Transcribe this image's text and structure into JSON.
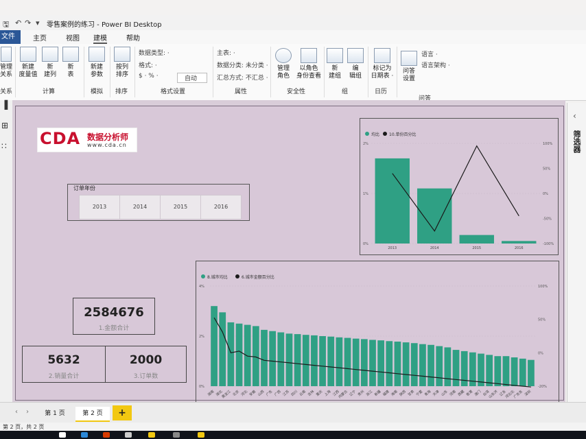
{
  "window": {
    "title": "零售案例的练习 - Power BI Desktop"
  },
  "menu": {
    "file": "文件",
    "tabs": [
      "主页",
      "视图",
      "建模",
      "帮助"
    ]
  },
  "ribbon": {
    "manage_rel": "管理\n关系",
    "new_measure": "新建\n度量值",
    "new_column": "新\n建列",
    "new_table": "新\n表",
    "new_param": "新建\n参数",
    "sort_by_col": "按列\n排序",
    "data_type": "数据类型: ·",
    "format": "格式: ·",
    "currency": "$ · % ·",
    "auto": "自动",
    "home_table": "主表: ·",
    "data_category": "数据分类: 未分类 ·",
    "summarize": "汇总方式: 不汇总 ·",
    "manage_roles": "管理\n角色",
    "view_as": "以角色\n身份查看",
    "new_group": "新\n建组",
    "edit_group": "编\n辑组",
    "mark_date": "标记为\n日期表 ·",
    "qa_setup": "问答\n设置",
    "language": "语言 ·",
    "linguistic": "语言架构 ·",
    "groups": {
      "relations": "关系",
      "calc": "计算",
      "whatif": "模拟",
      "sort": "排序",
      "formatting": "格式设置",
      "properties": "属性",
      "security": "安全性",
      "group": "组",
      "calendar": "日历",
      "qa": "问答"
    }
  },
  "right_panel": {
    "filters": "筛选器"
  },
  "slicer": {
    "title": "订单年份",
    "years": [
      "2013",
      "2014",
      "2015",
      "2016"
    ]
  },
  "cards": {
    "sales_amount": {
      "value": "2584676",
      "label": "1.金额合计"
    },
    "sales_qty": {
      "value": "5632",
      "label": "2.销量合计"
    },
    "order_count": {
      "value": "2000",
      "label": "3.订单数"
    }
  },
  "pages": {
    "page1": "第 1 页",
    "page2": "第 2 页",
    "add": "+"
  },
  "status": {
    "text": "第 2 页，共 2 页"
  },
  "chart_data": [
    {
      "type": "bar",
      "legend": [
        "均比",
        "10.单份百分比"
      ],
      "categories": [
        "2013",
        "2014",
        "2015",
        "2016"
      ],
      "series": [
        {
          "name": "均比",
          "values": [
            1.7,
            1.1,
            0.17,
            0.05
          ]
        },
        {
          "name": "10.单份百分比",
          "values": [
            40,
            -75,
            95,
            -45
          ]
        }
      ],
      "y_left_ticks": [
        "2%",
        "1%",
        "0%"
      ],
      "y_right_ticks": [
        "100%",
        "50%",
        "0%",
        "-50%",
        "-100%"
      ],
      "ylim": [
        0,
        2
      ],
      "y2lim": [
        -100,
        100
      ],
      "legend_position": "top-left",
      "colors": {
        "bar": "#2fa084",
        "line": "#1a1a1a"
      }
    },
    {
      "type": "bar",
      "legend": [
        "8.城市均比",
        "6.城市金额百分比"
      ],
      "categories": [
        "湖南",
        "湖北",
        "黑龙江",
        "北京",
        "河北",
        "安徽",
        "山西",
        "广东",
        "广西",
        "江苏",
        "四川",
        "云南",
        "吉林",
        "重庆",
        "上海",
        "江西",
        "内蒙古",
        "辽宁",
        "贵州",
        "浙江",
        "新疆",
        "福建",
        "海南",
        "陕西",
        "甘肃",
        "宁夏",
        "青海",
        "天津",
        "山东",
        "河南",
        "西藏",
        "香港",
        "澳门",
        "台湾",
        "山东济",
        "辽东",
        "河北北",
        "广东东",
        "深圳"
      ],
      "series": [
        {
          "name": "8.城市均比",
          "values": [
            3.2,
            2.95,
            2.55,
            2.5,
            2.45,
            2.4,
            2.25,
            2.2,
            2.15,
            2.1,
            2.08,
            2.05,
            2.03,
            2.0,
            1.98,
            1.95,
            1.93,
            1.9,
            1.88,
            1.85,
            1.83,
            1.8,
            1.78,
            1.75,
            1.72,
            1.68,
            1.65,
            1.6,
            1.55,
            1.45,
            1.4,
            1.35,
            1.3,
            1.25,
            1.2,
            1.2,
            1.15,
            1.1,
            1.05
          ]
        },
        {
          "name": "6.城市金额百分比",
          "values": [
            62,
            45,
            20,
            22,
            16,
            15,
            11,
            10,
            9,
            8,
            7,
            6,
            5,
            4,
            3,
            2,
            1,
            0,
            -1,
            -2,
            -3,
            -4,
            -5,
            -6,
            -7,
            -8,
            -9,
            -10,
            -11,
            -12,
            -13,
            -14,
            -15,
            -16,
            -17,
            -18,
            -19,
            -20,
            -21
          ]
        }
      ],
      "y_left_ticks": [
        "4%",
        "2%",
        "0%"
      ],
      "y_right_ticks": [
        "100%",
        "50%",
        "0%",
        "-20%"
      ],
      "ylim": [
        0,
        4
      ],
      "legend_position": "top-left",
      "colors": {
        "bar": "#2fa084",
        "line": "#1a1a1a"
      }
    }
  ]
}
